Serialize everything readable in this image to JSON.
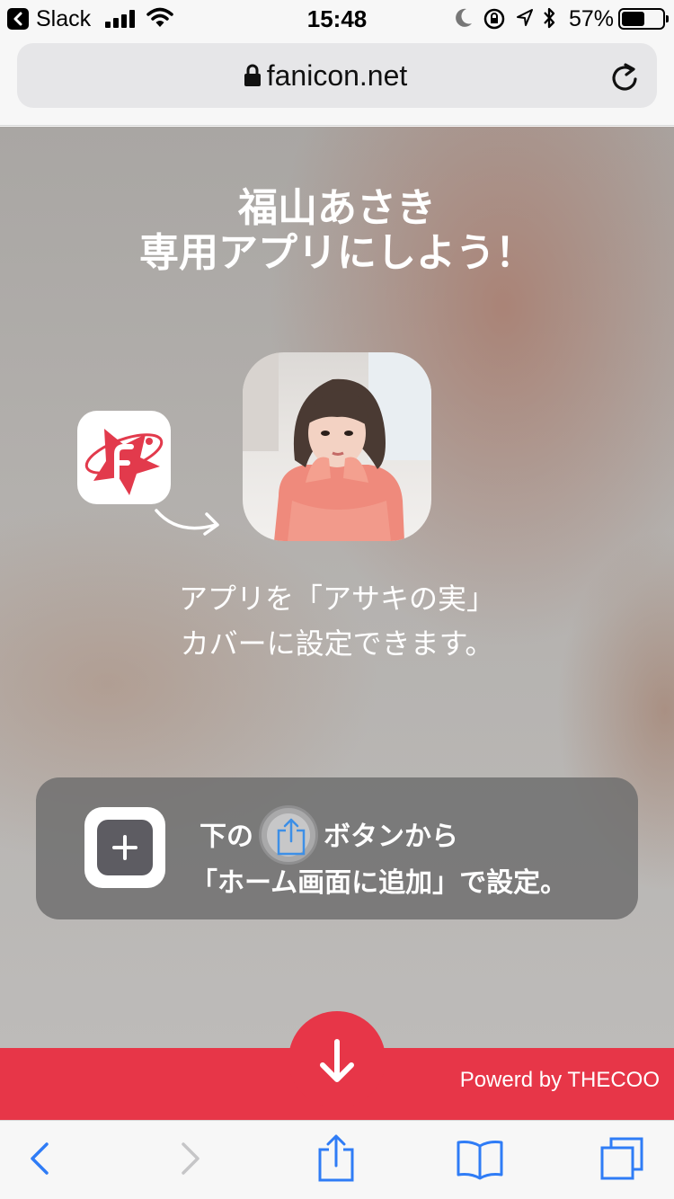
{
  "status_bar": {
    "back_app": "Slack",
    "time": "15:48",
    "battery_percent": "57%",
    "battery_level": 0.57,
    "icons": [
      "back-icon",
      "signal-icon",
      "wifi-icon",
      "moon-icon",
      "rotation-lock-icon",
      "location-icon",
      "bluetooth-icon",
      "battery-icon"
    ]
  },
  "browser": {
    "url": "fanicon.net",
    "icons": [
      "lock-icon",
      "reload-icon"
    ]
  },
  "page": {
    "title_line1": "福山あさき",
    "title_line2": "専用アプリにしよう！",
    "description_line1": "アプリを「アサキの実」",
    "description_line2": "カバーに設定できます。",
    "instruction_before": "下の",
    "instruction_after": "ボタンから",
    "instruction_line2": "「ホーム画面に追加」で設定。",
    "powered_by": "Powerd by THECOO",
    "accent_color": "#e73648",
    "icons": [
      "fanicon-app-icon",
      "curved-arrow-icon",
      "profile-photo",
      "add-to-home-icon",
      "share-icon",
      "down-arrow-icon"
    ]
  },
  "toolbar": {
    "icons": [
      "back-arrow-icon",
      "forward-arrow-icon",
      "share-icon",
      "bookmarks-icon",
      "tabs-icon"
    ]
  }
}
